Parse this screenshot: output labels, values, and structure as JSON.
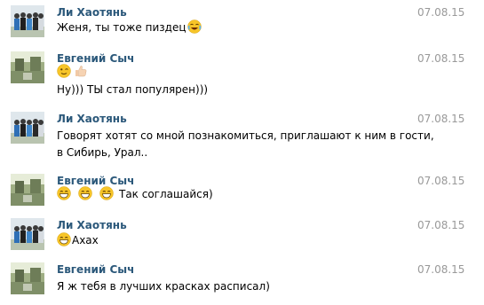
{
  "messages": [
    {
      "avatar": "group-photo-avatar",
      "author": "Ли Хаотянь",
      "date": "07.08.15",
      "lines": [
        {
          "text": "Женя, ты тоже пиздец",
          "emojis_after": [
            "laughing-tears-emoji"
          ]
        }
      ]
    },
    {
      "avatar": "landscape-photo-avatar",
      "author": "Евгений Сыч",
      "date": "07.08.15",
      "lines": [
        {
          "emojis_only": [
            "winking-face-emoji",
            "thumbs-up-emoji"
          ]
        },
        {
          "text": "Ну))) ТЫ стал популярен)))"
        }
      ]
    },
    {
      "avatar": "group-photo-avatar",
      "author": "Ли Хаотянь",
      "date": "07.08.15",
      "lines": [
        {
          "text": "Говорят хотят со мной познакомиться, приглашают к ним в гости,"
        },
        {
          "text": "в Сибирь, Урал.."
        }
      ]
    },
    {
      "avatar": "landscape-photo-avatar",
      "author": "Евгений Сыч",
      "date": "07.08.15",
      "lines": [
        {
          "emojis_before": [
            "grinning-face-emoji",
            "grinning-face-emoji",
            "grinning-face-emoji"
          ],
          "text": "Так соглашайся)"
        }
      ]
    },
    {
      "avatar": "group-photo-avatar",
      "author": "Ли Хаотянь",
      "date": "07.08.15",
      "lines": [
        {
          "emojis_before": [
            "grinning-face-emoji"
          ],
          "text": "Ахах"
        }
      ]
    },
    {
      "avatar": "landscape-photo-avatar",
      "author": "Евгений Сыч",
      "date": "07.08.15",
      "lines": [
        {
          "text": "Я ж тебя в лучших красках расписал)"
        }
      ]
    }
  ],
  "colors": {
    "author": "#2b587a",
    "date": "#999999",
    "text": "#000000",
    "emoji_face": "#f7c528"
  }
}
